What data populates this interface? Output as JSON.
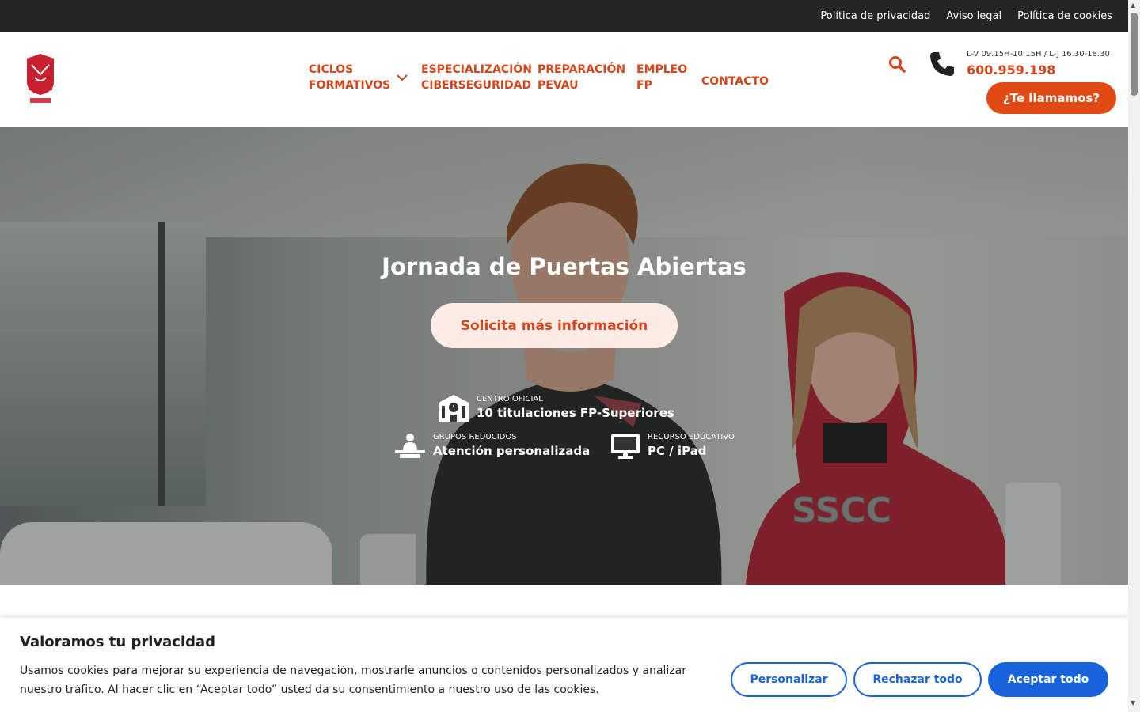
{
  "topbar": {
    "links": [
      "Política de privacidad",
      "Aviso legal",
      "Política de cookies"
    ]
  },
  "header": {
    "logo_alt": "San José FESAC",
    "nav": [
      {
        "line1": "CICLOS",
        "line2": "FORMATIVOS",
        "has_dropdown": true
      },
      {
        "line1": "ESPECIALIZACIÓN",
        "line2": "CIBERSEGURIDAD",
        "has_dropdown": false
      },
      {
        "line1": "PREPARACIÓN",
        "line2": "PEVAU",
        "has_dropdown": false
      },
      {
        "line1": "EMPLEO",
        "line2": "FP",
        "has_dropdown": false
      },
      {
        "line1": "CONTACTO",
        "line2": "",
        "has_dropdown": false
      }
    ],
    "hours": "L-V 09.15H-10:15H / L-J 16.30-18.30",
    "phone": "600.959.198",
    "call_button": "¿Te llamamos?",
    "accent_color": "#d4461b"
  },
  "hero": {
    "title": "Jornada de Puertas Abiertas",
    "cta": "Solicita más información",
    "features": [
      {
        "icon": "school-building-icon",
        "small": "CENTRO OFICIAL",
        "big": "10 titulaciones FP-Superiores"
      },
      {
        "icon": "teacher-desk-icon",
        "small": "GRUPOS REDUCIDOS",
        "big": "Atención personalizada"
      },
      {
        "icon": "monitor-icon",
        "small": "RECURSO EDUCATIVO",
        "big": "PC / iPad"
      }
    ]
  },
  "cookie_banner": {
    "title": "Valoramos tu privacidad",
    "text": "Usamos cookies para mejorar su experiencia de navegación, mostrarle anuncios o contenidos personalizados y analizar nuestro tráfico. Al hacer clic en “Aceptar todo” usted da su consentimiento a nuestro uso de las cookies.",
    "buttons": {
      "customize": "Personalizar",
      "reject": "Rechazar todo",
      "accept": "Aceptar todo"
    },
    "button_color": "#1863dc"
  }
}
